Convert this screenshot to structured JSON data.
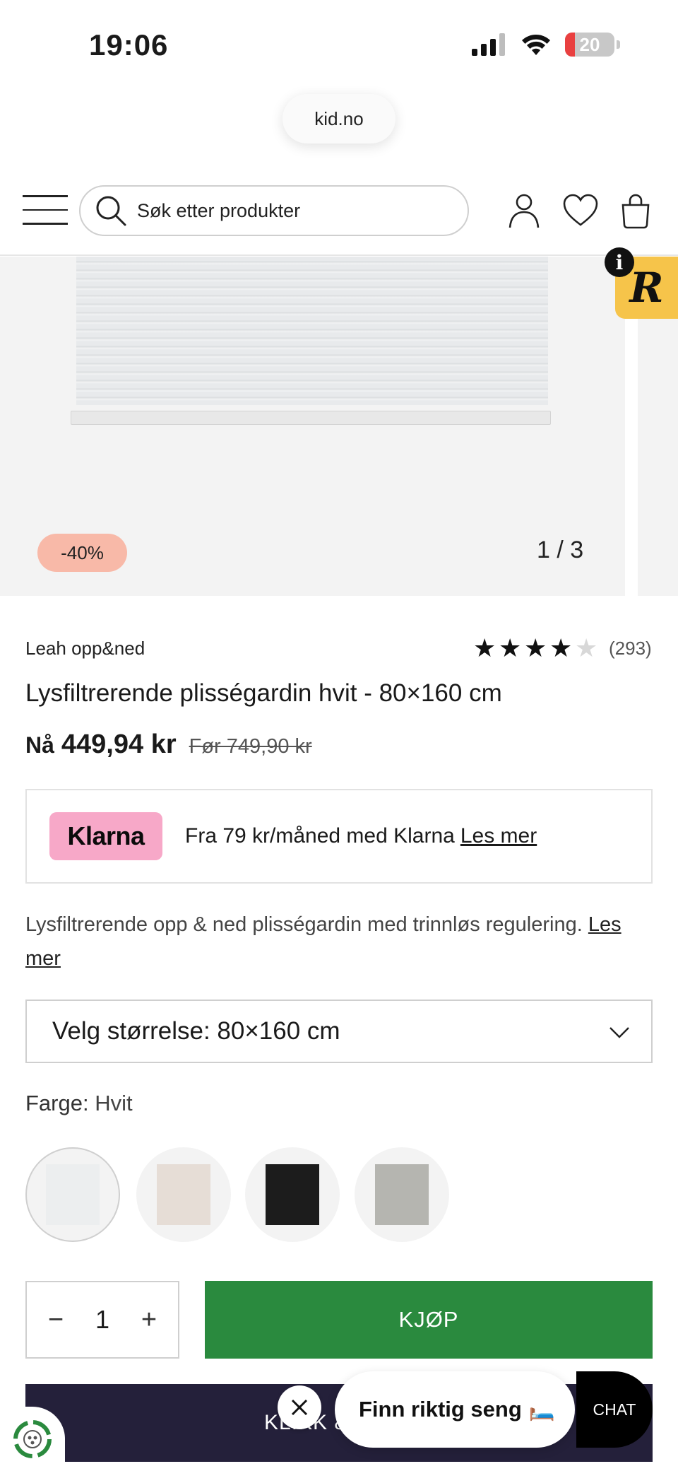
{
  "status_bar": {
    "time": "19:06",
    "battery_level": "20",
    "battery_fraction": 0.2,
    "battery_color": "#e94040"
  },
  "browser": {
    "url": "kid.no"
  },
  "header": {
    "search_placeholder": "Søk etter produkter",
    "icons": [
      "menu-icon",
      "search-icon",
      "account-icon",
      "heart-icon",
      "bag-icon"
    ]
  },
  "gallery": {
    "discount_badge": "-40%",
    "counter": "1 / 3",
    "badge_letter": "R",
    "info_letter": "i",
    "badge_color": "#f6c44a"
  },
  "product": {
    "brand": "Leah opp&ned",
    "rating": {
      "stars": 4,
      "max": 5,
      "count": "(293)"
    },
    "title": "Lysfiltrerende plisségardin hvit - 80×160 cm",
    "price": {
      "now_label": "Nå",
      "now": "449,94 kr",
      "before": "Før 749,90 kr"
    }
  },
  "klarna": {
    "logo_text": "Klarna",
    "text": "Fra 79 kr/måned med Klarna",
    "link": "Les mer",
    "logo_color": "#f7a8c8"
  },
  "description": {
    "text": "Lysfiltrerende opp & ned plisségardin med trinnløs regulering.",
    "link": "Les mer"
  },
  "size_select": {
    "selected": "Velg størrelse: 80×160 cm"
  },
  "color": {
    "label": "Farge:",
    "value": "Hvit",
    "swatches": [
      {
        "name": "hvit",
        "color": "#eceeef",
        "selected": true
      },
      {
        "name": "beige",
        "color": "#e6ddd6",
        "selected": false
      },
      {
        "name": "svart",
        "color": "#1c1c1c",
        "selected": false
      },
      {
        "name": "grå",
        "color": "#b5b5b0",
        "selected": false
      }
    ]
  },
  "purchase": {
    "quantity": "1",
    "minus": "−",
    "plus": "+",
    "buy_label": "KJØP",
    "buy_color": "#2a8a3e",
    "secondary_label": "KLIKK &"
  },
  "floating": {
    "help_text": "Finn riktig seng",
    "help_emoji": "🛏️",
    "chat_label": "CHAT"
  }
}
